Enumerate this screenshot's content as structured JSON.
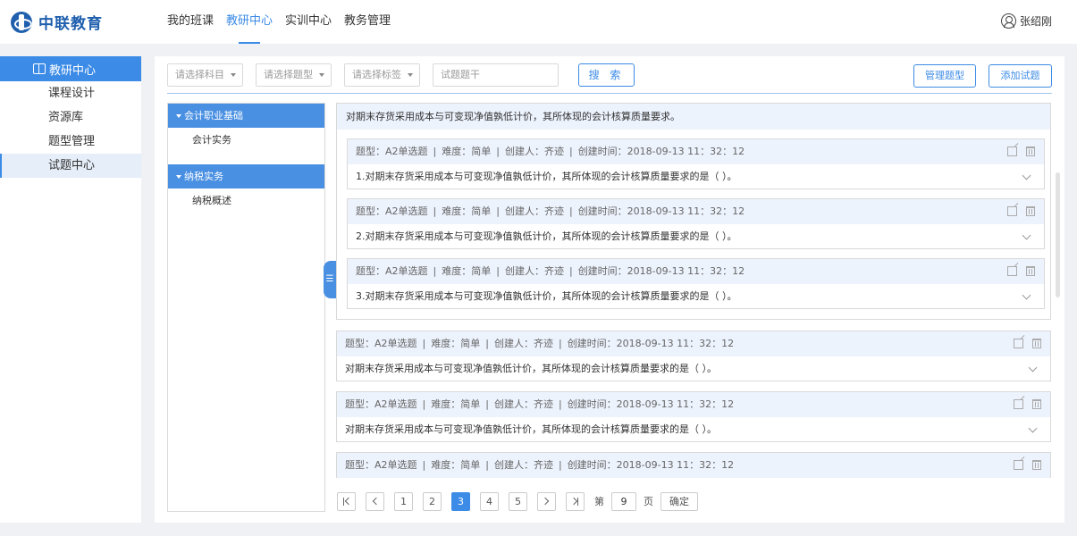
{
  "header": {
    "logo_text": "中联教育",
    "nav": [
      "我的班课",
      "教研中心",
      "实训中心",
      "教务管理"
    ],
    "active_nav": "教研中心",
    "user_name": "张绍刚"
  },
  "sidebar": {
    "title": "教研中心",
    "items": [
      "课程设计",
      "资源库",
      "题型管理",
      "试题中心"
    ],
    "active_item": "试题中心"
  },
  "filters": {
    "subject": "请选择科目",
    "type": "请选择题型",
    "tag": "请选择标签",
    "keyword_placeholder": "试题题干",
    "search_label": "搜 索",
    "manage_types_label": "管理题型",
    "add_question_label": "添加试题"
  },
  "tree": [
    {
      "category": "会计职业基础",
      "children": [
        "会计实务"
      ]
    },
    {
      "category": "纳税实务",
      "children": [
        "纳税概述"
      ]
    }
  ],
  "collapse_glyph": "☰",
  "meta": {
    "type": "题型：A2单选题",
    "difficulty": "难度：简单",
    "creator": "创建人：齐迹",
    "created": "创建时间：2018-09-13  11：32：12",
    "sep": "|"
  },
  "group": {
    "title": "对期末存货采用成本与可变现净值孰低计价，其所体现的会计核算质量要求。",
    "questions": [
      "1.对期末存货采用成本与可变现净值孰低计价，其所体现的会计核算质量要求的是（   ）。",
      "2.对期末存货采用成本与可变现净值孰低计价，其所体现的会计核算质量要求的是（   ）。",
      "3.对期末存货采用成本与可变现净值孰低计价，其所体现的会计核算质量要求的是（   ）。"
    ]
  },
  "standalone": [
    "对期末存货采用成本与可变现净值孰低计价，其所体现的会计核算质量要求的是（   ）。",
    "对期末存货采用成本与可变现净值孰低计价，其所体现的会计核算质量要求的是（   ）。",
    ""
  ],
  "pagination": {
    "pages": [
      "1",
      "2",
      "3",
      "4",
      "5"
    ],
    "current": "3",
    "goto_prefix": "第",
    "goto_value": "9",
    "goto_suffix": "页",
    "confirm_label": "确定"
  },
  "colors": {
    "accent": "#3c8be6",
    "header_bg": "#edf3fd"
  }
}
